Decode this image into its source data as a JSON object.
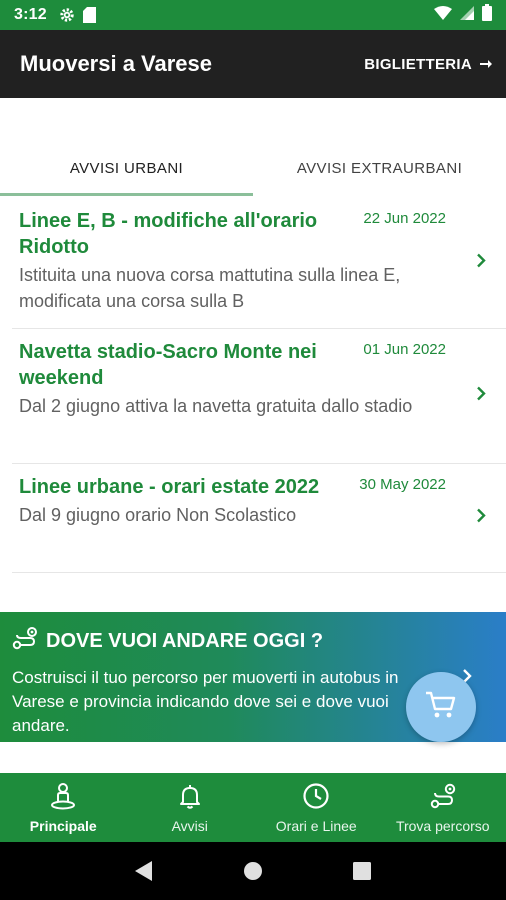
{
  "status_bar": {
    "time": "3:12"
  },
  "app_bar": {
    "title": "Muoversi a Varese",
    "action_label": "BIGLIETTERIA"
  },
  "tabs": [
    {
      "label": "AVVISI URBANI",
      "active": true
    },
    {
      "label": "AVVISI EXTRAURBANI",
      "active": false
    }
  ],
  "news": [
    {
      "title": "Linee E, B - modifiche all'orario Ridotto",
      "date": "22 Jun 2022",
      "body": "Istituita una nuova corsa mattutina sulla linea E, modificata una corsa sulla B"
    },
    {
      "title": "Navetta stadio-Sacro Monte nei weekend",
      "date": "01 Jun 2022",
      "body": "Dal 2 giugno attiva la navetta gratuita dallo stadio"
    },
    {
      "title": "Linee urbane - orari estate 2022",
      "date": "30 May 2022",
      "body": "Dal 9 giugno orario Non Scolastico"
    }
  ],
  "banner": {
    "title": "DOVE VUOI ANDARE OGGI ?",
    "text": "Costruisci il tuo percorso per muoverti in autobus in Varese e provincia indicando dove sei e dove vuoi andare."
  },
  "bottom_nav": [
    {
      "label": "Principale",
      "icon": "person-pin-icon",
      "active": true
    },
    {
      "label": "Avvisi",
      "icon": "bell-icon",
      "active": false
    },
    {
      "label": "Orari e Linee",
      "icon": "clock-icon",
      "active": false
    },
    {
      "label": "Trova percorso",
      "icon": "route-icon",
      "active": false
    }
  ],
  "colors": {
    "primary": "#1e8c3c",
    "app_bar": "#212121",
    "fab": "#8ec6ef",
    "accent_text": "#1f8a3b"
  }
}
